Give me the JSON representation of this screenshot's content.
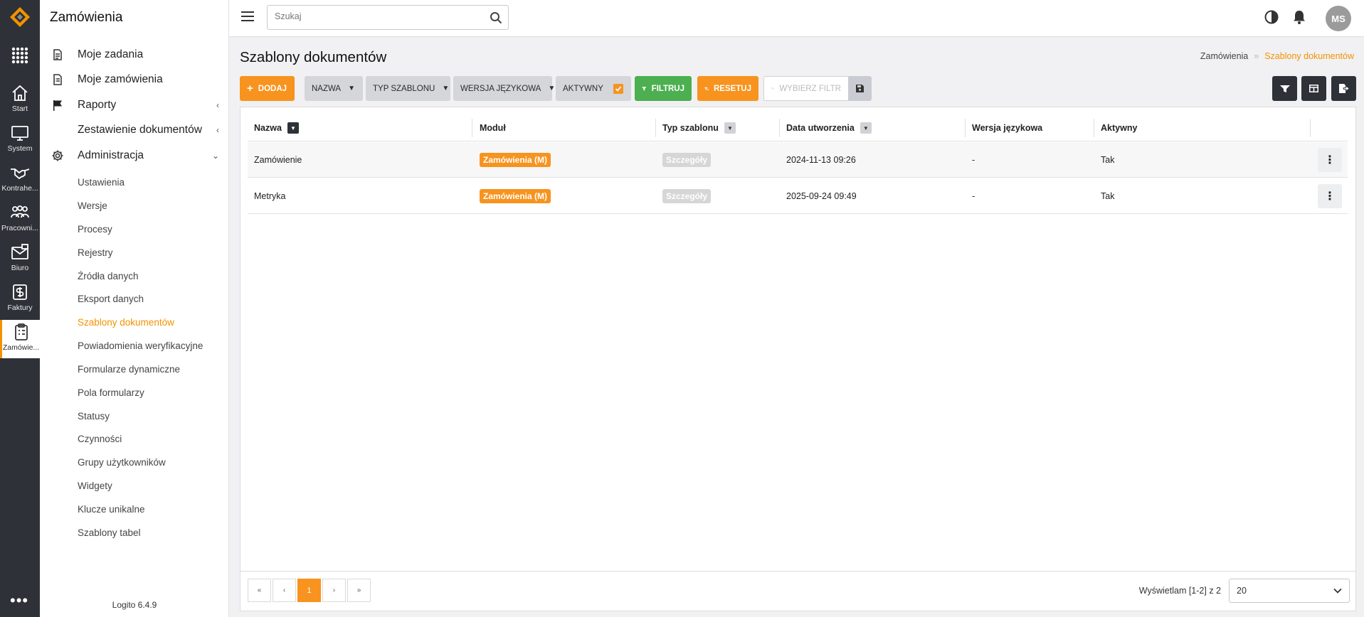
{
  "rail": {
    "items": [
      {
        "label": "Start",
        "icon": "home-icon"
      },
      {
        "label": "System",
        "icon": "monitor-icon"
      },
      {
        "label": "Kontrahe...",
        "icon": "handshake-icon"
      },
      {
        "label": "Pracowni...",
        "icon": "people-icon"
      },
      {
        "label": "Biuro",
        "icon": "mail-icon"
      },
      {
        "label": "Faktury",
        "icon": "dollar-icon"
      },
      {
        "label": "Zamówie...",
        "icon": "clipboard-icon"
      }
    ],
    "more": "•••"
  },
  "sidebar": {
    "title": "Zamówienia",
    "main_items": [
      {
        "label": "Moje zadania",
        "icon": "document-icon"
      },
      {
        "label": "Moje zamówienia",
        "icon": "document-list-icon"
      },
      {
        "label": "Raporty",
        "icon": "flag-icon",
        "chevron": "‹"
      },
      {
        "label": "Zestawienie dokumentów",
        "chevron": "‹"
      },
      {
        "label": "Administracja",
        "icon": "gear-icon",
        "chevron": "⌄"
      }
    ],
    "sub_items": [
      "Ustawienia",
      "Wersje",
      "Procesy",
      "Rejestry",
      "Źródła danych",
      "Eksport danych",
      "Szablony dokumentów",
      "Powiadomienia weryfikacyjne",
      "Formularze dynamiczne",
      "Pola formularzy",
      "Statusy",
      "Czynności",
      "Grupy użytkowników",
      "Widgety",
      "Klucze unikalne",
      "Szablony tabel"
    ],
    "active_sub": "Szablony dokumentów",
    "version": "Logito 6.4.9"
  },
  "topbar": {
    "search_placeholder": "Szukaj",
    "avatar": "MS"
  },
  "page": {
    "title": "Szablony dokumentów",
    "breadcrumb": [
      "Zamówienia",
      "Szablony dokumentów"
    ],
    "breadcrumb_sep": "»"
  },
  "toolbar": {
    "add": "DODAJ",
    "name": "NAZWA",
    "template_type": "TYP SZABLONU",
    "lang_version": "WERSJA JĘZYKOWA",
    "active": "AKTYWNY",
    "filter": "FILTRUJ",
    "reset": "RESETUJ",
    "choose_filter": "WYBIERZ FILTR"
  },
  "table": {
    "columns": [
      "Nazwa",
      "Moduł",
      "Typ szablonu",
      "Data utworzenia",
      "Wersja językowa",
      "Aktywny"
    ],
    "rows": [
      {
        "name": "Zamówienie",
        "module": "Zamówienia (M)",
        "type": "Szczegóły",
        "created": "2024-11-13 09:26",
        "lang": "-",
        "active": "Tak"
      },
      {
        "name": "Metryka",
        "module": "Zamówienia (M)",
        "type": "Szczegóły",
        "created": "2025-09-24 09:49",
        "lang": "-",
        "active": "Tak"
      }
    ]
  },
  "pagination": {
    "first": "«",
    "prev": "‹",
    "current": "1",
    "next": "›",
    "last": "»",
    "showing": "Wyświetlam [1-2] z 2",
    "page_size": "20"
  },
  "colors": {
    "accent": "#f7931e",
    "dark": "#2e3238",
    "green": "#4caf50"
  }
}
